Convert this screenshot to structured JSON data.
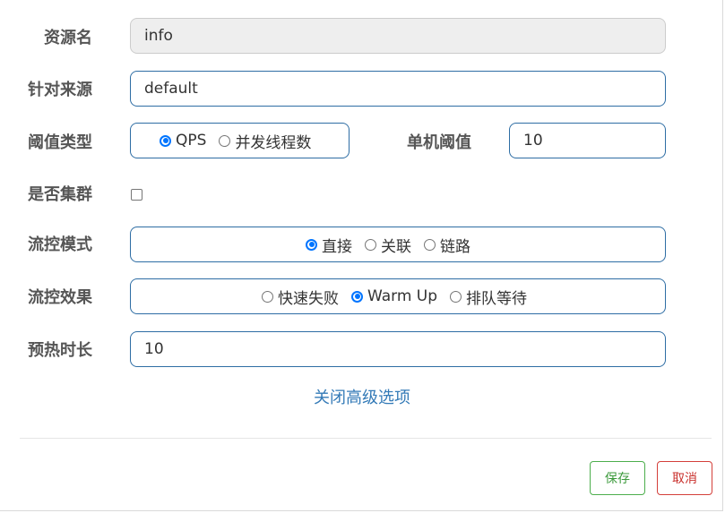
{
  "form": {
    "resource_name": {
      "label": "资源名",
      "value": "info"
    },
    "limit_app": {
      "label": "针对来源",
      "value": "default"
    },
    "threshold_type": {
      "label": "阈值类型",
      "options": [
        {
          "label": "QPS",
          "checked": true
        },
        {
          "label": "并发线程数",
          "checked": false
        }
      ]
    },
    "single_threshold": {
      "label": "单机阈值",
      "value": "10"
    },
    "cluster": {
      "label": "是否集群",
      "checked": false
    },
    "strategy": {
      "label": "流控模式",
      "options": [
        {
          "label": "直接",
          "checked": true
        },
        {
          "label": "关联",
          "checked": false
        },
        {
          "label": "链路",
          "checked": false
        }
      ]
    },
    "control_behavior": {
      "label": "流控效果",
      "options": [
        {
          "label": "快速失败",
          "checked": false
        },
        {
          "label": "Warm Up",
          "checked": true
        },
        {
          "label": "排队等待",
          "checked": false
        }
      ]
    },
    "warm_up_period": {
      "label": "预热时长",
      "value": "10"
    },
    "advanced_toggle": "关闭高级选项"
  },
  "footer": {
    "save_label": "保存",
    "cancel_label": "取消"
  },
  "colors": {
    "input_border": "#2e6da4",
    "radio_checked": "#0075ff",
    "link": "#337ab7",
    "save": "#4cae4c",
    "cancel": "#d43f3a"
  }
}
